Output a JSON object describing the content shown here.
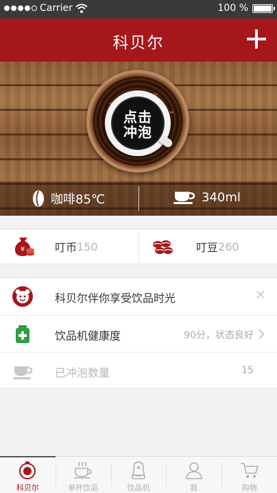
{
  "status_bar": {
    "carrier": "Carrier",
    "battery": "100 %",
    "battery_level": 1.0,
    "time": ""
  },
  "nav": {
    "title": "科贝尔"
  },
  "hero": {
    "brew_line1": "点击",
    "brew_line2": "冲泡",
    "coffee_temp": "咖啡85℃",
    "cup_volume": "340ml"
  },
  "stats": {
    "coins_label": "叮币",
    "coins_value": "150",
    "beans_label": "叮豆",
    "beans_value": "260"
  },
  "list": {
    "promo": {
      "text": "科贝尔伴你享受饮品时光"
    },
    "health": {
      "label": "饮品机健康度",
      "value": "90分，状态良好"
    },
    "count": {
      "label": "已冲泡数量",
      "value": "15"
    }
  },
  "tabs": [
    {
      "label": "科贝尔",
      "icon": "brand-icon",
      "active": true
    },
    {
      "label": "单杯饮品",
      "icon": "cup-icon"
    },
    {
      "label": "饮品机",
      "icon": "machine-icon"
    },
    {
      "label": "我",
      "icon": "user-icon"
    },
    {
      "label": "购物",
      "icon": "cart-icon"
    }
  ],
  "colors": {
    "brand_red": "#a5171b",
    "tab_inactive": "#b0b0b0",
    "health_green": "#2f9e44"
  }
}
